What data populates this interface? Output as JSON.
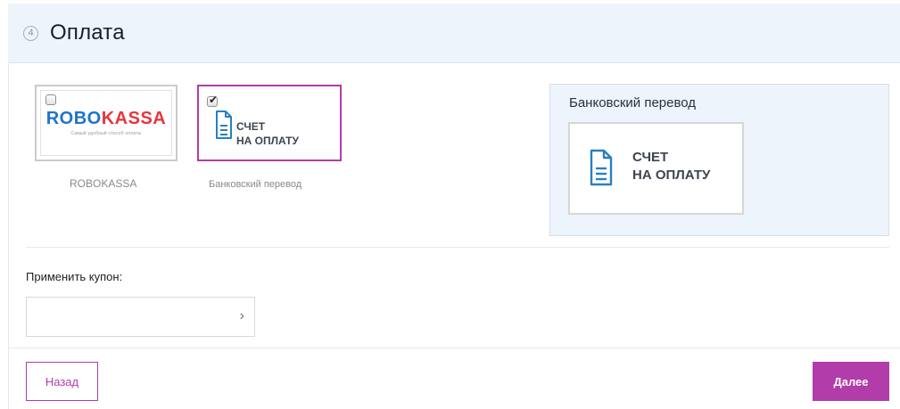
{
  "header": {
    "step_number": "4",
    "title": "Оплата"
  },
  "payment_methods": [
    {
      "id": "robokassa",
      "logo_part_1": "ROBO",
      "logo_part_2": "KASSA",
      "tagline": "Самый удобный способ оплаты",
      "caption": "ROBOKASSA",
      "checked": false
    },
    {
      "id": "bank",
      "invoice_line_1": "СЧЕТ",
      "invoice_line_2": "НА ОПЛАТУ",
      "caption": "Банковский перевод",
      "checked": true,
      "checkmark": "✔"
    }
  ],
  "selected_method_panel": {
    "title": "Банковский перевод",
    "invoice_line_1": "СЧЕТ",
    "invoice_line_2": "НА ОПЛАТУ"
  },
  "coupon": {
    "label": "Применить купон:",
    "value": "",
    "placeholder": "",
    "submit_icon": "chevron-right-icon",
    "submit_glyph": "›"
  },
  "navigation": {
    "back_label": "Назад",
    "next_label": "Далее"
  },
  "colors": {
    "accent": "#b23ca9",
    "header_bg": "#eef4fb",
    "robo_blue": "#1f74c9",
    "kassa_red": "#e8353b",
    "doc_icon_blue": "#2a7fc1"
  }
}
